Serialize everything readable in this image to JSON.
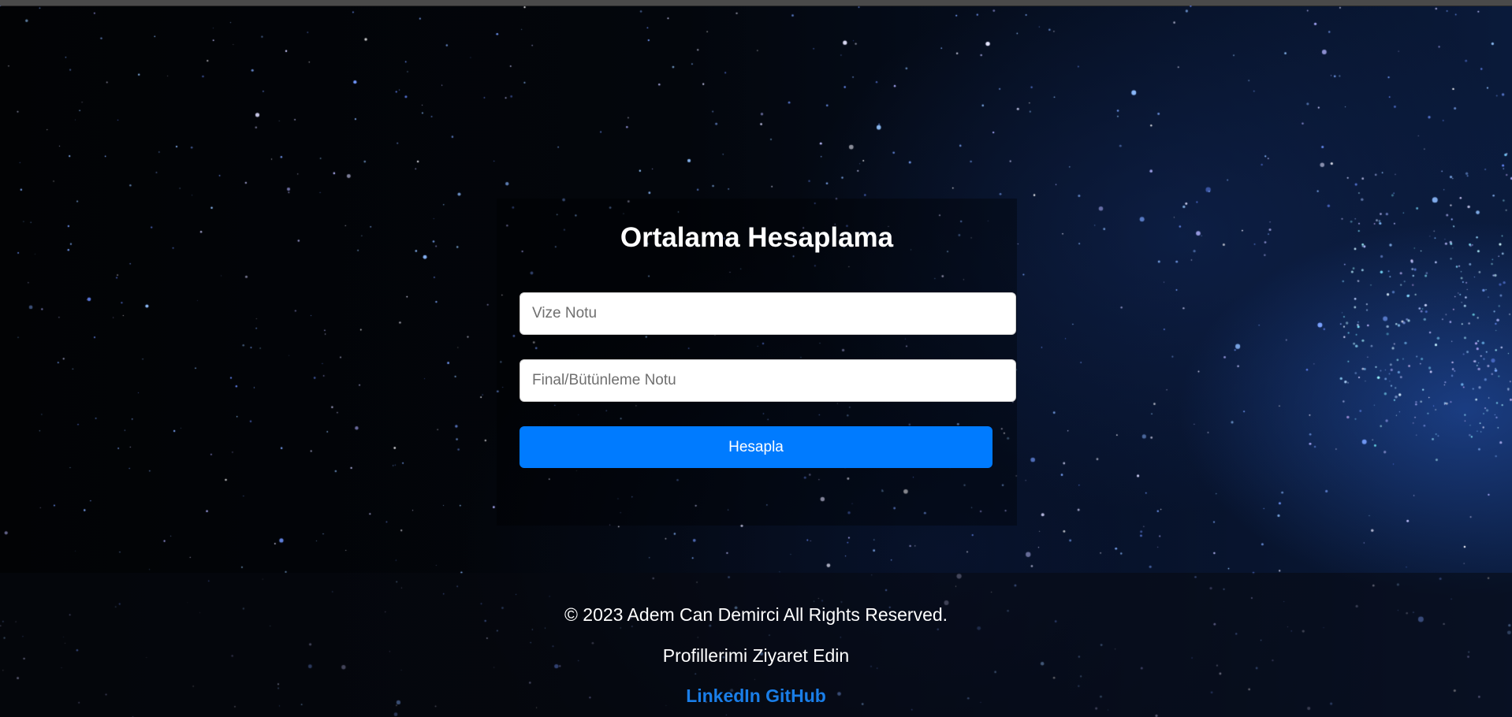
{
  "form": {
    "title": "Ortalama Hesaplama",
    "vize_placeholder": "Vize Notu",
    "vize_value": "",
    "final_placeholder": "Final/Bütünleme Notu",
    "final_value": "",
    "submit_label": "Hesapla"
  },
  "footer": {
    "copyright": "© 2023 Adem Can Demirci All Rights Reserved.",
    "profiles_label": "Profillerimi Ziyaret Edin",
    "links": [
      {
        "label": "LinkedIn"
      },
      {
        "label": "GitHub"
      }
    ]
  },
  "colors": {
    "accent": "#007bff",
    "link": "#1a7ee8",
    "background": "#020305",
    "text": "#ffffff"
  }
}
